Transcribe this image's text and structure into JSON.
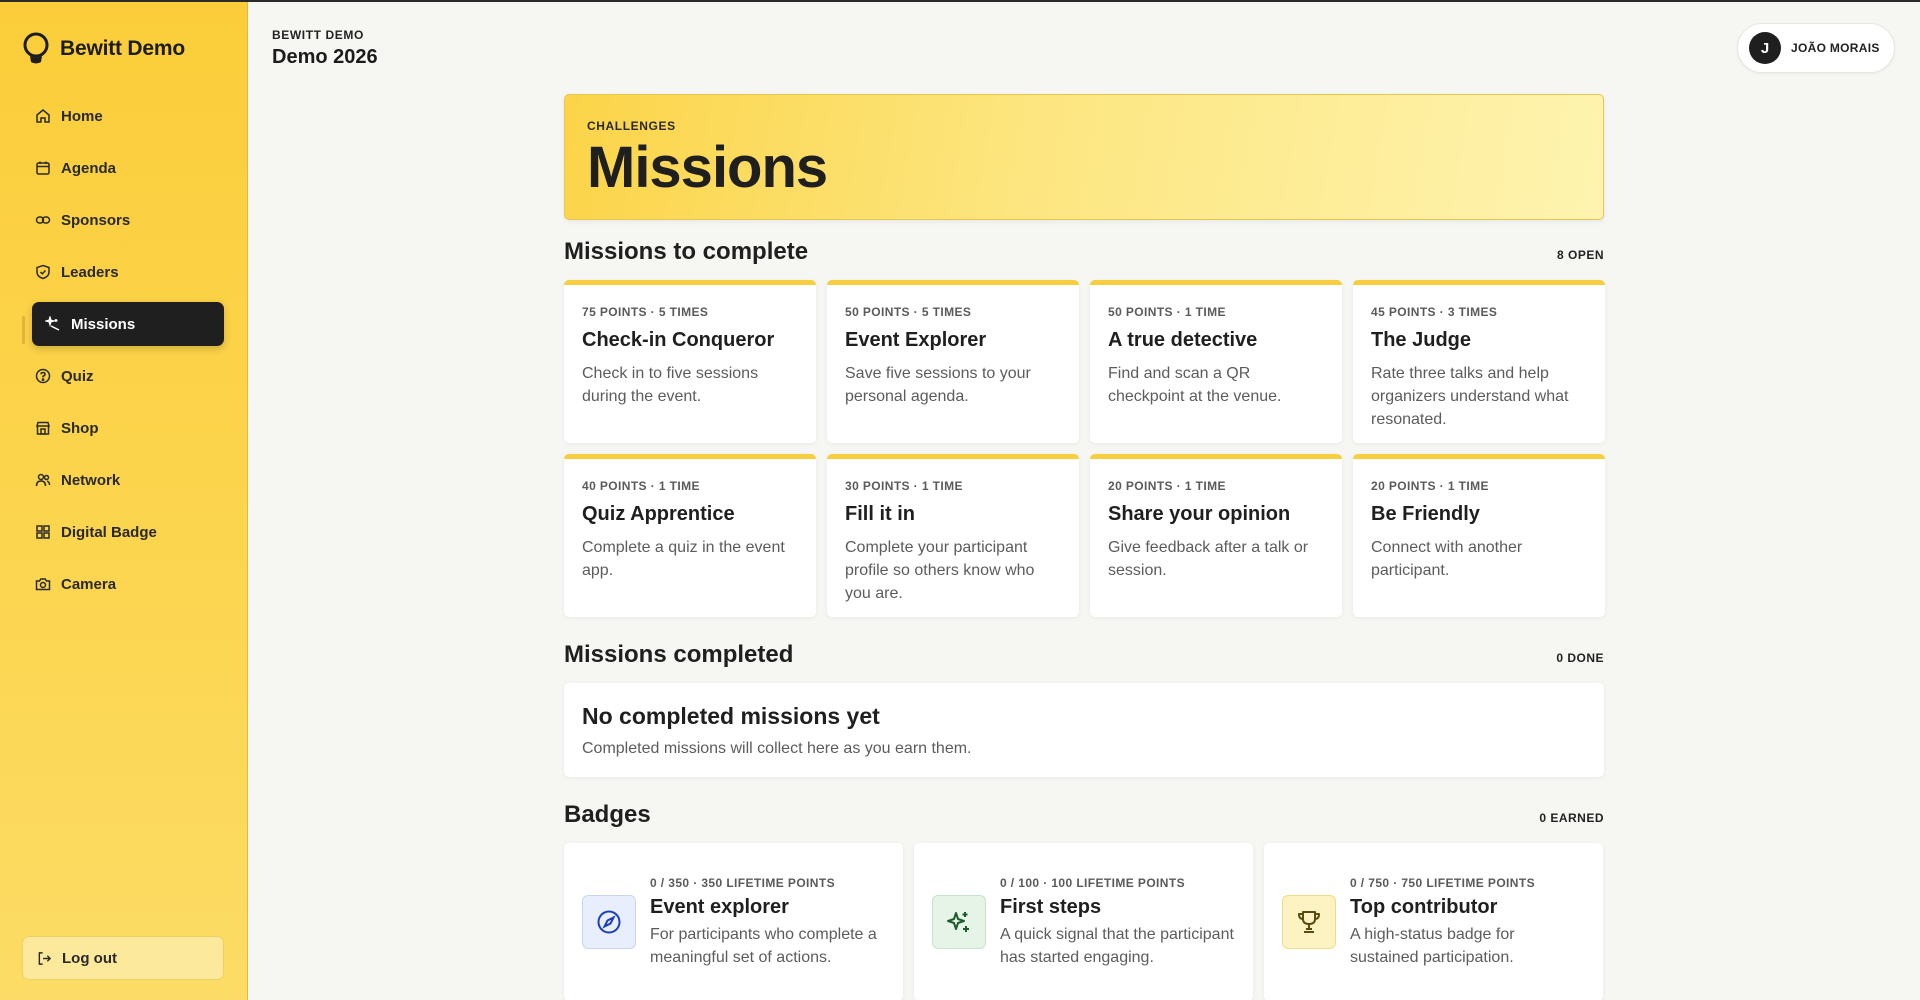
{
  "brand": {
    "name": "Bewitt Demo",
    "icon": "lightbulb-icon"
  },
  "sidebar": {
    "items": [
      {
        "label": "Home",
        "icon": "home-icon"
      },
      {
        "label": "Agenda",
        "icon": "calendar-icon"
      },
      {
        "label": "Sponsors",
        "icon": "link-icon"
      },
      {
        "label": "Leaders",
        "icon": "shield-icon"
      },
      {
        "label": "Missions",
        "icon": "sparkle-wand-icon",
        "active": true
      },
      {
        "label": "Quiz",
        "icon": "help-circle-icon"
      },
      {
        "label": "Shop",
        "icon": "store-icon"
      },
      {
        "label": "Network",
        "icon": "users-icon"
      },
      {
        "label": "Digital Badge",
        "icon": "grid-icon"
      },
      {
        "label": "Camera",
        "icon": "camera-icon"
      }
    ],
    "logout_label": "Log out"
  },
  "header": {
    "org": "BEWITT DEMO",
    "event": "Demo 2026",
    "user_initial": "J",
    "user_name": "JOÃO MORAIS"
  },
  "hero": {
    "kicker": "CHALLENGES",
    "title": "Missions"
  },
  "missions_open": {
    "title": "Missions to complete",
    "count": "8 OPEN",
    "cards": [
      {
        "meta": "75 POINTS · 5 TIMES",
        "title": "Check-in Conqueror",
        "desc": "Check in to five sessions during the event."
      },
      {
        "meta": "50 POINTS · 5 TIMES",
        "title": "Event Explorer",
        "desc": "Save five sessions to your personal agenda."
      },
      {
        "meta": "50 POINTS · 1 TIME",
        "title": "A true detective",
        "desc": "Find and scan a QR checkpoint at the venue."
      },
      {
        "meta": "45 POINTS · 3 TIMES",
        "title": "The Judge",
        "desc": "Rate three talks and help organizers understand what resonated."
      },
      {
        "meta": "40 POINTS · 1 TIME",
        "title": "Quiz Apprentice",
        "desc": "Complete a quiz in the event app."
      },
      {
        "meta": "30 POINTS · 1 TIME",
        "title": "Fill it in",
        "desc": "Complete your participant profile so others know who you are."
      },
      {
        "meta": "20 POINTS · 1 TIME",
        "title": "Share your opinion",
        "desc": "Give feedback after a talk or session."
      },
      {
        "meta": "20 POINTS · 1 TIME",
        "title": "Be Friendly",
        "desc": "Connect with another participant."
      }
    ]
  },
  "missions_completed": {
    "title": "Missions completed",
    "count": "0 DONE",
    "empty_title": "No completed missions yet",
    "empty_desc": "Completed missions will collect here as you earn them."
  },
  "badges": {
    "title": "Badges",
    "count": "0 EARNED",
    "items": [
      {
        "meta": "0 / 350 · 350 LIFETIME POINTS",
        "title": "Event explorer",
        "desc": "For participants who complete a meaningful set of actions.",
        "icon": "compass-icon",
        "color": "#1d3fb8"
      },
      {
        "meta": "0 / 100 · 100 LIFETIME POINTS",
        "title": "First steps",
        "desc": "A quick signal that the participant has started engaging.",
        "icon": "sparkles-icon",
        "color": "#1f5a2c"
      },
      {
        "meta": "0 / 750 · 750 LIFETIME POINTS",
        "title": "Top contributor",
        "desc": "A high-status badge for sustained participation.",
        "icon": "trophy-icon",
        "color": "#5a4a10"
      }
    ]
  },
  "colors": {
    "accent": "#fbcd3a",
    "dark": "#1f1f1f",
    "card_border": "#f7ce3e"
  }
}
